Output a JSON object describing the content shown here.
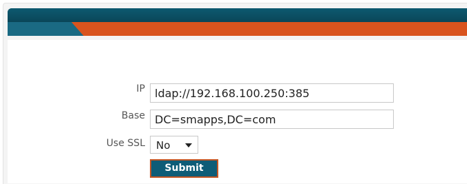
{
  "form": {
    "ip": {
      "label": "IP",
      "value": "ldap://192.168.100.250:385"
    },
    "base": {
      "label": "Base",
      "value": "DC=smapps,DC=com"
    },
    "use_ssl": {
      "label": "Use SSL",
      "selected": "No"
    },
    "submit_label": "Submit"
  },
  "colors": {
    "header_dark": "#0b4a5e",
    "header_orange": "#d9541e",
    "button_bg": "#0e5c77",
    "button_border": "#c35523"
  }
}
